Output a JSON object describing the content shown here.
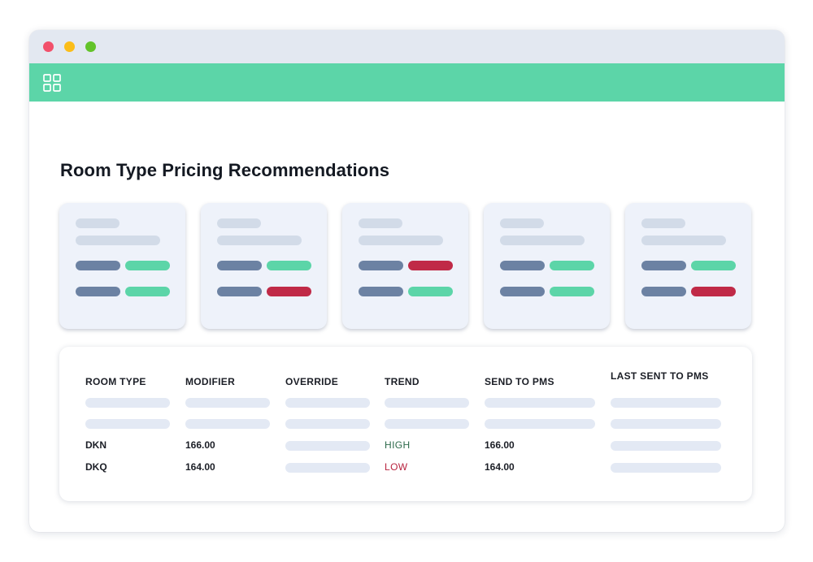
{
  "page": {
    "title": "Room Type Pricing Recommendations"
  },
  "colors": {
    "brand_green": "#5cd5a8",
    "negative_red": "#c02a47",
    "neutral_slate": "#6c82a3",
    "titlebar_bg": "#e3e8f1",
    "card_bg": "#eef2fa",
    "placeholder": "#e3e9f4",
    "trend_high_text": "#2d6a4b",
    "trend_low_text": "#b8233f"
  },
  "toolbar": {
    "icon": "apps-grid-icon"
  },
  "cards": [
    {
      "row1_status": "positive",
      "row2_status": "positive"
    },
    {
      "row1_status": "positive",
      "row2_status": "negative"
    },
    {
      "row1_status": "negative",
      "row2_status": "positive"
    },
    {
      "row1_status": "positive",
      "row2_status": "positive"
    },
    {
      "row1_status": "positive",
      "row2_status": "negative"
    }
  ],
  "table": {
    "headers": {
      "room_type": "ROOM TYPE",
      "modifier": "MODIFIER",
      "override": "OVERRIDE",
      "trend": "TREND",
      "send_to_pms": "SEND TO PMS",
      "last_sent_to_pms": "LAST SENT TO PMS"
    },
    "rows": [
      {
        "room_type": "DKN",
        "modifier": "166.00",
        "trend": "HIGH",
        "send_to_pms": "166.00"
      },
      {
        "room_type": "DKQ",
        "modifier": "164.00",
        "trend": "LOW",
        "send_to_pms": "164.00"
      }
    ]
  }
}
